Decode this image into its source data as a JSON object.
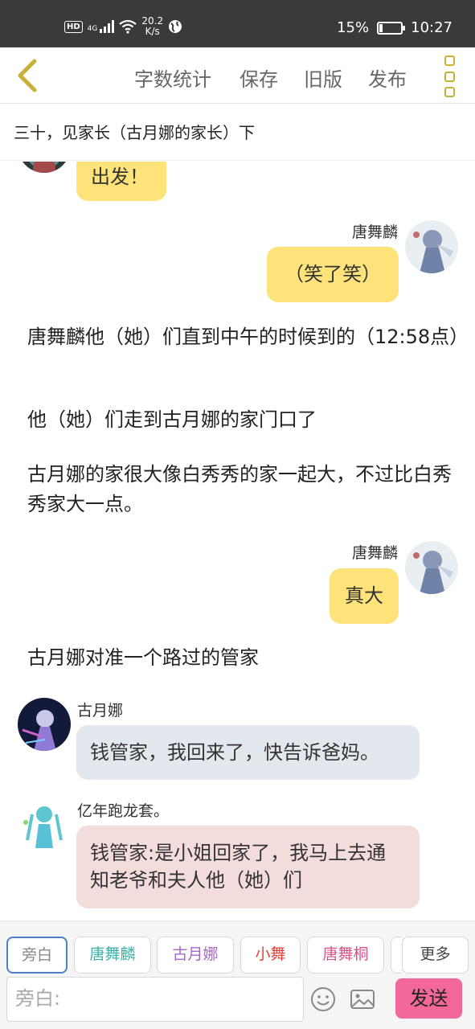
{
  "status_bar": {
    "hd_label": "HD",
    "network_label": "4G",
    "speed_value": "20.2",
    "speed_unit": "K/s",
    "battery_percent": "15%",
    "battery_level": 0.15,
    "time": "10:27"
  },
  "toolbar": {
    "back_icon": "chevron-left-icon",
    "items": [
      "字数统计",
      "保存",
      "旧版",
      "发布"
    ],
    "more_icon": "more-vertical-icon"
  },
  "chapter": {
    "title": "三十，见家长（古月娜的家长）下"
  },
  "messages": [
    {
      "type": "left-bubble",
      "color": "yellow",
      "text": "出发！"
    },
    {
      "type": "right",
      "sender": "唐舞麟",
      "color": "yellow",
      "text": "（笑了笑）"
    },
    {
      "type": "narration",
      "text": "唐舞麟他（她）们直到中午的时候到的（12:58点）"
    },
    {
      "type": "narration",
      "text": "他（她）们走到古月娜的家门口了"
    },
    {
      "type": "narration",
      "text": "古月娜的家很大像白秀秀的家一起大，不过比白秀秀家大一点。"
    },
    {
      "type": "right",
      "sender": "唐舞麟",
      "color": "yellow",
      "text": "真大"
    },
    {
      "type": "narration",
      "text": "古月娜对准一个路过的管家"
    },
    {
      "type": "left",
      "sender": "古月娜",
      "color": "blue",
      "text": "钱管家，我回来了，快告诉爸妈。"
    },
    {
      "type": "left",
      "sender": "亿年跑龙套。",
      "color": "pink",
      "text": "钱管家:是小姐回家了，我马上去通知老爷和夫人他（她）们"
    }
  ],
  "role_tabs": [
    {
      "label": "旁白",
      "color": "#888888",
      "active": true
    },
    {
      "label": "唐舞麟",
      "color": "#3bb3a8",
      "active": false
    },
    {
      "label": "古月娜",
      "color": "#a768c9",
      "active": false
    },
    {
      "label": "小舞",
      "color": "#e0443a",
      "active": false
    },
    {
      "label": "唐舞桐",
      "color": "#d6558a",
      "active": false
    },
    {
      "label": "更多",
      "color": "#444444",
      "active": false
    }
  ],
  "input": {
    "placeholder": "旁白:",
    "value": ""
  },
  "icons": {
    "emoji": "smiley-icon",
    "image": "image-icon"
  },
  "send_label": "发送",
  "colors": {
    "accent_yellow": "#fde37a",
    "bubble_blue": "#e3e8ef",
    "bubble_pink": "#f2dcdc",
    "send_pink": "#f3689a",
    "active_tab_border": "#4f7fc9",
    "more_icon_color": "#c9b03a"
  }
}
